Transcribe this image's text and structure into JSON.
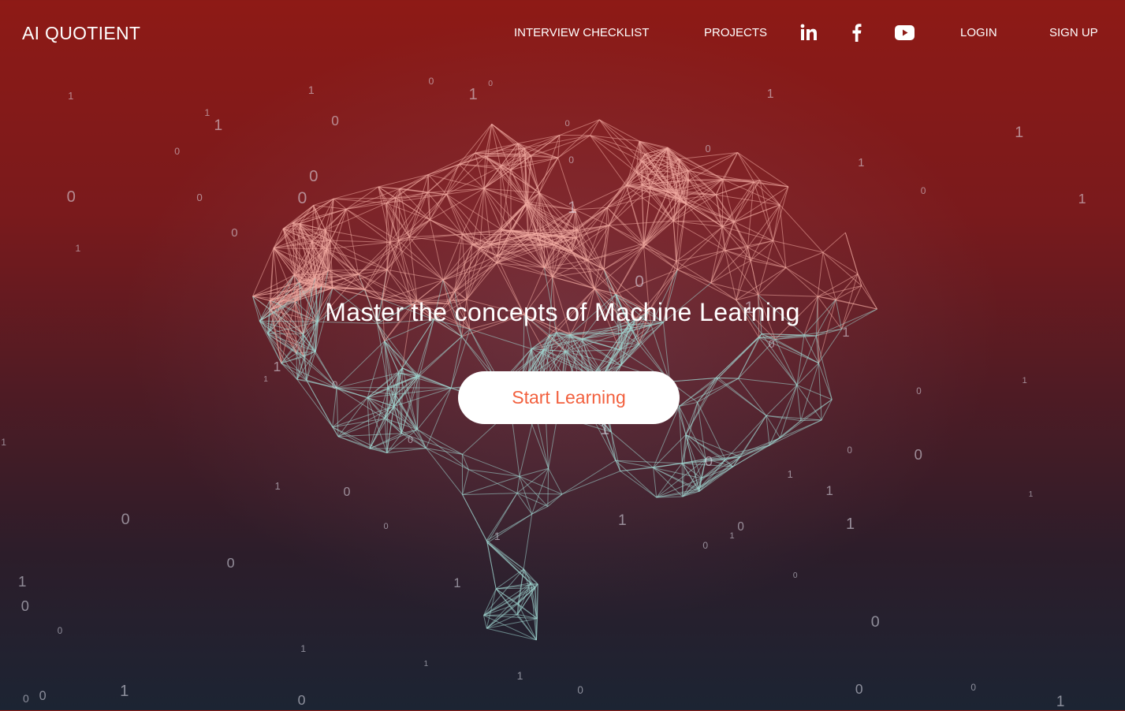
{
  "brand": {
    "logo": "AI QUOTIENT",
    "accent": "#f2603e"
  },
  "nav": {
    "interview_checklist": "INTERVIEW CHECKLIST",
    "projects": "PROJECTS",
    "icons": [
      "linkedin-icon",
      "facebook-icon",
      "youtube-icon"
    ],
    "login": "LOGIN",
    "signup": "SIGN UP"
  },
  "hero": {
    "title": "Master the concepts of Machine Learning",
    "cta": "Start Learning"
  }
}
